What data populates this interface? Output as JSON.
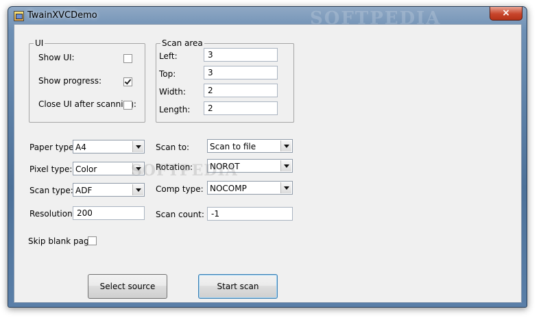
{
  "window": {
    "title": "TwainXVCDemo",
    "close_label": "×"
  },
  "watermark": "SOFTPEDIA",
  "ui_group": {
    "legend": "UI",
    "show_ui": {
      "label": "Show UI:",
      "checked": false
    },
    "show_progress": {
      "label": "Show progress:",
      "checked": true
    },
    "close_ui": {
      "label": "Close UI after scanning:",
      "checked": false
    }
  },
  "scan_area": {
    "legend": "Scan area",
    "left": {
      "label": "Left:",
      "value": "3"
    },
    "top": {
      "label": "Top:",
      "value": "3"
    },
    "width": {
      "label": "Width:",
      "value": "2"
    },
    "length": {
      "label": "Length:",
      "value": "2"
    }
  },
  "settings": {
    "paper_type": {
      "label": "Paper type:",
      "value": "A4"
    },
    "pixel_type": {
      "label": "Pixel type:",
      "value": "Color"
    },
    "scan_type": {
      "label": "Scan type:",
      "value": "ADF"
    },
    "resolution": {
      "label": "Resolution:",
      "value": "200"
    },
    "scan_to": {
      "label": "Scan to:",
      "value": "Scan to file"
    },
    "rotation": {
      "label": "Rotation:",
      "value": "NOROT"
    },
    "comp_type": {
      "label": "Comp type:",
      "value": "NOCOMP"
    },
    "scan_count": {
      "label": "Scan count:",
      "value": "-1"
    },
    "skip_blank": {
      "label": "Skip blank page:",
      "checked": false
    }
  },
  "buttons": {
    "select_source": "Select source",
    "start_scan": "Start scan"
  }
}
